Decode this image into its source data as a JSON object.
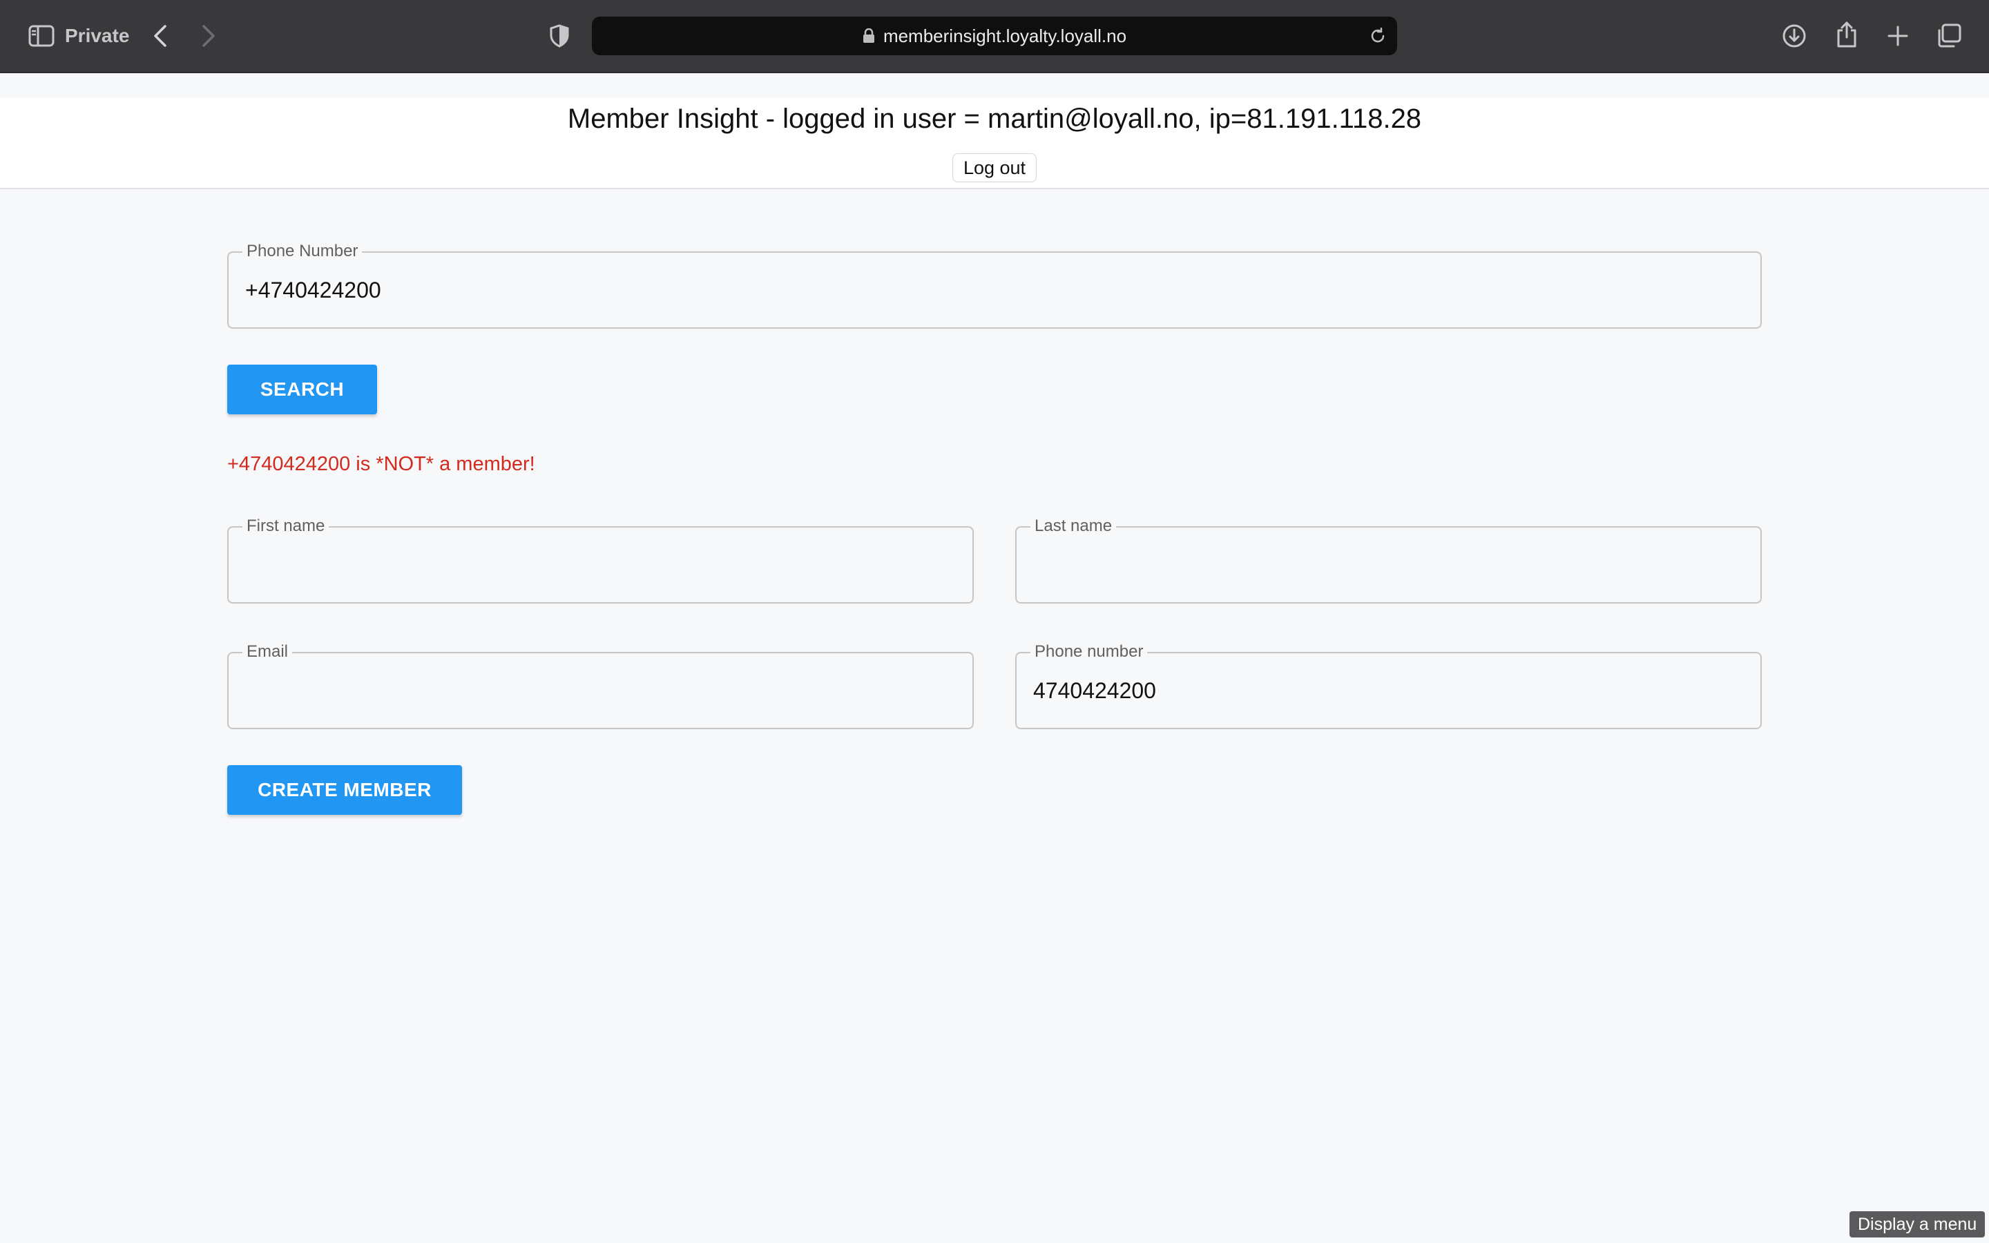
{
  "browser": {
    "mode_label": "Private",
    "url": "memberinsight.loyalty.loyall.no"
  },
  "header": {
    "title": "Member Insight - logged in user = martin@loyall.no, ip=81.191.118.28",
    "logout_label": "Log out"
  },
  "search": {
    "phone_label": "Phone Number",
    "phone_value": "+4740424200",
    "button_label": "SEARCH"
  },
  "result": {
    "message": "+4740424200 is *NOT* a member!",
    "color": "#d22b1e"
  },
  "create_form": {
    "first_name_label": "First name",
    "first_name_value": "",
    "last_name_label": "Last name",
    "last_name_value": "",
    "email_label": "Email",
    "email_value": "",
    "phone_label": "Phone number",
    "phone_value": "4740424200",
    "button_label": "CREATE MEMBER"
  },
  "tooltip": {
    "text": "Display a menu"
  },
  "colors": {
    "accent": "#2196f3",
    "toolbar": "#39393b",
    "page_bg": "#f7f8fa"
  }
}
